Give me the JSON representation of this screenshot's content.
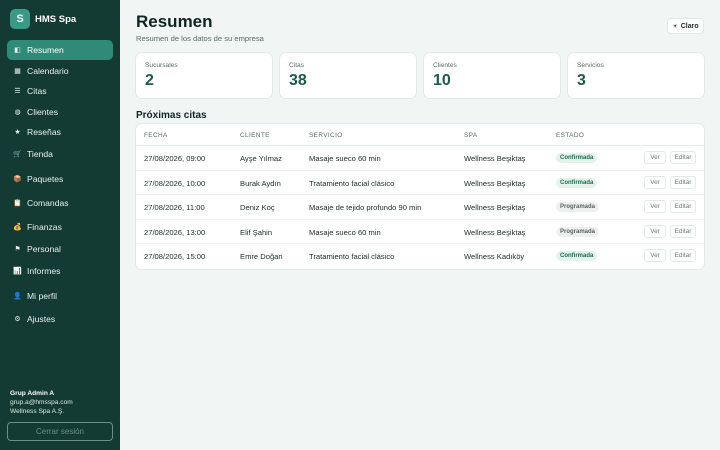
{
  "brand": {
    "logo_letter": "S",
    "name": "HMS Spa"
  },
  "nav": [
    {
      "label": "Resumen",
      "icon": "◧",
      "icon_name": "dashboard-icon",
      "active": true
    },
    {
      "label": "Calendario",
      "icon": "▦",
      "icon_name": "calendar-icon"
    },
    {
      "label": "Citas",
      "icon": "☰",
      "icon_name": "list-icon"
    },
    {
      "label": "Clientes",
      "icon": "◍",
      "icon_name": "clients-icon"
    },
    {
      "label": "Reseñas",
      "icon": "★",
      "icon_name": "star-icon"
    },
    {
      "label": "Tienda",
      "icon": "🛒",
      "icon_name": "cart-icon"
    },
    {
      "label": "Paquetes",
      "icon": "📦",
      "icon_name": "package-icon"
    },
    {
      "label": "Comandas",
      "icon": "📋",
      "icon_name": "clipboard-icon"
    },
    {
      "label": "Finanzas",
      "icon": "💰",
      "icon_name": "money-bag-icon"
    },
    {
      "label": "Personal",
      "icon": "⚑",
      "icon_name": "staff-icon"
    },
    {
      "label": "Informes",
      "icon": "📊",
      "icon_name": "chart-icon"
    },
    {
      "label": "Mi perfil",
      "icon": "👤",
      "icon_name": "user-icon"
    },
    {
      "label": "Ajustes",
      "icon": "⚙",
      "icon_name": "gear-icon"
    }
  ],
  "user": {
    "name": "Grup Admin A",
    "email": "grup.a@hmsspa.com",
    "company": "Wellness Spa A.Ş.",
    "logout_label": "Cerrar sesión"
  },
  "header": {
    "title": "Resumen",
    "subtitle": "Resumen de los datos de su empresa",
    "theme_label": "Claro",
    "theme_icon": "☀"
  },
  "stats": [
    {
      "label": "Sucursales",
      "value": "2"
    },
    {
      "label": "Citas",
      "value": "38"
    },
    {
      "label": "Clientes",
      "value": "10"
    },
    {
      "label": "Servicios",
      "value": "3"
    }
  ],
  "appointments": {
    "title": "Próximas citas",
    "columns": [
      "FECHA",
      "CLIENTE",
      "SERVICIO",
      "SPA",
      "ESTADO"
    ],
    "view_label": "Ver",
    "edit_label": "Editar",
    "rows": [
      {
        "date": "27/08/2026, 09:00",
        "client": "Ayşe Yılmaz",
        "service": "Masaje sueco 60 min",
        "spa": "Wellness Beşiktaş",
        "status": "Confirmada",
        "status_kind": "conf"
      },
      {
        "date": "27/08/2026, 10:00",
        "client": "Burak Aydın",
        "service": "Tratamiento facial clásico",
        "spa": "Wellness Beşiktaş",
        "status": "Confirmada",
        "status_kind": "conf"
      },
      {
        "date": "27/08/2026, 11:00",
        "client": "Deniz Koç",
        "service": "Masaje de tejido profundo 90 min",
        "spa": "Wellness Beşiktaş",
        "status": "Programada",
        "status_kind": "prog"
      },
      {
        "date": "27/08/2026, 13:00",
        "client": "Elif Şahin",
        "service": "Masaje sueco 60 min",
        "spa": "Wellness Beşiktaş",
        "status": "Programada",
        "status_kind": "prog"
      },
      {
        "date": "27/08/2026, 15:00",
        "client": "Emre Doğan",
        "service": "Tratamiento facial clásico",
        "spa": "Wellness Kadıköy",
        "status": "Confirmada",
        "status_kind": "conf"
      }
    ]
  }
}
